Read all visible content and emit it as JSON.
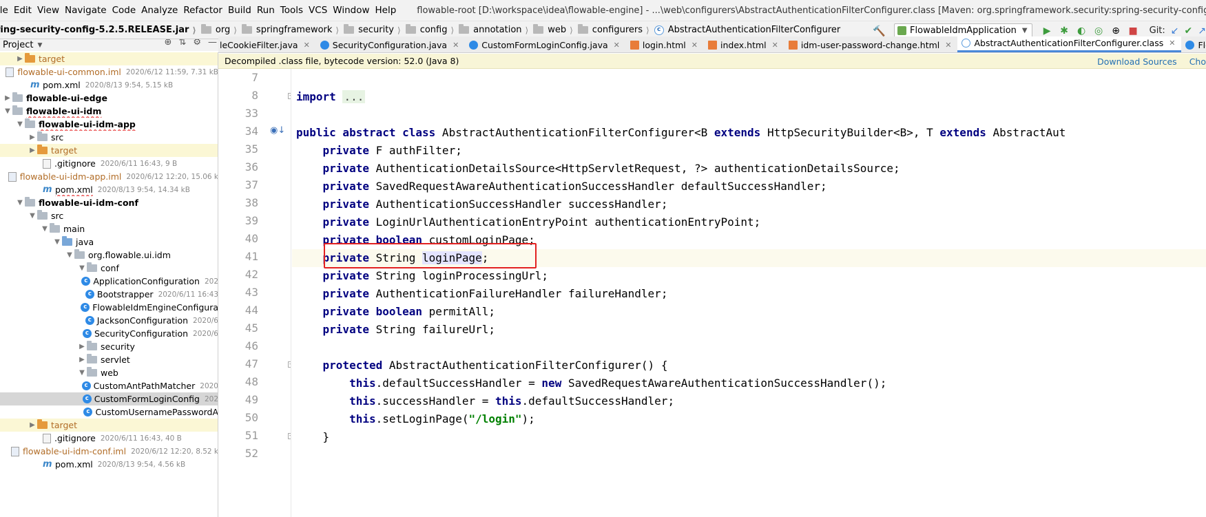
{
  "menu": [
    "ile",
    "Edit",
    "View",
    "Navigate",
    "Code",
    "Analyze",
    "Refactor",
    "Build",
    "Run",
    "Tools",
    "VCS",
    "Window",
    "Help"
  ],
  "window_title": "flowable-root [D:\\workspace\\idea\\flowable-engine] - ...\\web\\configurers\\AbstractAuthenticationFilterConfigurer.class [Maven: org.springframework.security:spring-security-config:5.2.5.RELEASE]",
  "breadcrumb": {
    "jar": "ring-security-config-5.2.5.RELEASE.jar",
    "segments": [
      "org",
      "springframework",
      "security",
      "config",
      "annotation",
      "web",
      "configurers"
    ],
    "class": "AbstractAuthenticationFilterConfigurer"
  },
  "toolbar": {
    "run_config": "FlowableIdmApplication",
    "git_label": "Git:"
  },
  "project": {
    "title": "Project",
    "rows": [
      {
        "name": "target",
        "meta": ""
      },
      {
        "name": "flowable-ui-common.iml",
        "meta": "2020/6/12 11:59, 7.31 kB"
      },
      {
        "name": "pom.xml",
        "meta": "2020/8/13 9:54, 5.15 kB"
      },
      {
        "name": "flowable-ui-edge",
        "meta": ""
      },
      {
        "name": "flowable-ui-idm",
        "meta": ""
      },
      {
        "name": "flowable-ui-idm-app",
        "meta": ""
      },
      {
        "name": "src",
        "meta": ""
      },
      {
        "name": "target",
        "meta": ""
      },
      {
        "name": ".gitignore",
        "meta": "2020/6/11 16:43, 9 B"
      },
      {
        "name": "flowable-ui-idm-app.iml",
        "meta": "2020/6/12 12:20, 15.06 k"
      },
      {
        "name": "pom.xml",
        "meta": "2020/8/13 9:54, 14.34 kB"
      },
      {
        "name": "flowable-ui-idm-conf",
        "meta": ""
      },
      {
        "name": "src",
        "meta": ""
      },
      {
        "name": "main",
        "meta": ""
      },
      {
        "name": "java",
        "meta": ""
      },
      {
        "name": "org.flowable.ui.idm",
        "meta": ""
      },
      {
        "name": "conf",
        "meta": ""
      },
      {
        "name": "ApplicationConfiguration",
        "meta": "202"
      },
      {
        "name": "Bootstrapper",
        "meta": "2020/6/11 16:43"
      },
      {
        "name": "FlowableIdmEngineConfigura",
        "meta": ""
      },
      {
        "name": "JacksonConfiguration",
        "meta": "2020/6"
      },
      {
        "name": "SecurityConfiguration",
        "meta": "2020/6"
      },
      {
        "name": "security",
        "meta": ""
      },
      {
        "name": "servlet",
        "meta": ""
      },
      {
        "name": "web",
        "meta": ""
      },
      {
        "name": "CustomAntPathMatcher",
        "meta": "2020"
      },
      {
        "name": "CustomFormLoginConfig",
        "meta": "202"
      },
      {
        "name": "CustomUsernamePasswordA",
        "meta": ""
      },
      {
        "name": "target",
        "meta": ""
      },
      {
        "name": ".gitignore",
        "meta": "2020/6/11 16:43, 40 B"
      },
      {
        "name": "flowable-ui-idm-conf.iml",
        "meta": "2020/6/12 12:20, 8.52 k"
      },
      {
        "name": "pom.xml",
        "meta": "2020/8/13 9:54, 4.56 kB"
      }
    ]
  },
  "tabs": [
    {
      "label": "leCookieFilter.java"
    },
    {
      "label": "SecurityConfiguration.java"
    },
    {
      "label": "CustomFormLoginConfig.java"
    },
    {
      "label": "login.html"
    },
    {
      "label": "index.html"
    },
    {
      "label": "idm-user-password-change.html"
    },
    {
      "label": "AbstractAuthenticationFilterConfigurer.class"
    },
    {
      "label": "FlowableIdmA"
    }
  ],
  "banner": {
    "message": "Decompiled .class file, bytecode version: 52.0 (Java 8)",
    "download_sources": "Download Sources",
    "choose_sources": "Cho"
  },
  "code": {
    "line_numbers": [
      "7",
      "8",
      "33",
      "34",
      "35",
      "36",
      "37",
      "38",
      "39",
      "40",
      "41",
      "42",
      "43",
      "44",
      "45",
      "46",
      "47",
      "48",
      "49",
      "50",
      "51",
      "52"
    ],
    "lines": [
      [],
      [
        {
          "k": "kw",
          "t": "import"
        },
        {
          "k": "p",
          "t": " "
        },
        {
          "k": "fold",
          "t": "..."
        }
      ],
      [],
      [
        {
          "k": "kw",
          "t": "public abstract class"
        },
        {
          "k": "p",
          "t": " AbstractAuthenticationFilterConfigurer<B "
        },
        {
          "k": "kw",
          "t": "extends"
        },
        {
          "k": "p",
          "t": " HttpSecurityBuilder<B>, T "
        },
        {
          "k": "kw",
          "t": "extends"
        },
        {
          "k": "p",
          "t": " AbstractAut"
        }
      ],
      [
        {
          "k": "p",
          "t": "    "
        },
        {
          "k": "kw",
          "t": "private"
        },
        {
          "k": "p",
          "t": " F authFilter;"
        }
      ],
      [
        {
          "k": "p",
          "t": "    "
        },
        {
          "k": "kw",
          "t": "private"
        },
        {
          "k": "p",
          "t": " AuthenticationDetailsSource<HttpServletRequest, ?> authenticationDetailsSource;"
        }
      ],
      [
        {
          "k": "p",
          "t": "    "
        },
        {
          "k": "kw",
          "t": "private"
        },
        {
          "k": "p",
          "t": " SavedRequestAwareAuthenticationSuccessHandler defaultSuccessHandler;"
        }
      ],
      [
        {
          "k": "p",
          "t": "    "
        },
        {
          "k": "kw",
          "t": "private"
        },
        {
          "k": "p",
          "t": " AuthenticationSuccessHandler successHandler;"
        }
      ],
      [
        {
          "k": "p",
          "t": "    "
        },
        {
          "k": "kw",
          "t": "private"
        },
        {
          "k": "p",
          "t": " LoginUrlAuthenticationEntryPoint authenticationEntryPoint;"
        }
      ],
      [
        {
          "k": "p",
          "t": "    "
        },
        {
          "k": "kw",
          "t": "private boolean"
        },
        {
          "k": "p",
          "t": " customLoginPage;"
        }
      ],
      [
        {
          "k": "p",
          "t": "    "
        },
        {
          "k": "kw",
          "t": "private"
        },
        {
          "k": "p",
          "t": " String "
        },
        {
          "k": "id",
          "t": "loginPage"
        },
        {
          "k": "p",
          "t": ";"
        }
      ],
      [
        {
          "k": "p",
          "t": "    "
        },
        {
          "k": "kw",
          "t": "private"
        },
        {
          "k": "p",
          "t": " String loginProcessingUrl;"
        }
      ],
      [
        {
          "k": "p",
          "t": "    "
        },
        {
          "k": "kw",
          "t": "private"
        },
        {
          "k": "p",
          "t": " AuthenticationFailureHandler failureHandler;"
        }
      ],
      [
        {
          "k": "p",
          "t": "    "
        },
        {
          "k": "kw",
          "t": "private boolean"
        },
        {
          "k": "p",
          "t": " permitAll;"
        }
      ],
      [
        {
          "k": "p",
          "t": "    "
        },
        {
          "k": "kw",
          "t": "private"
        },
        {
          "k": "p",
          "t": " String failureUrl;"
        }
      ],
      [],
      [
        {
          "k": "p",
          "t": "    "
        },
        {
          "k": "kw",
          "t": "protected"
        },
        {
          "k": "p",
          "t": " AbstractAuthenticationFilterConfigurer() {"
        }
      ],
      [
        {
          "k": "p",
          "t": "        "
        },
        {
          "k": "kw",
          "t": "this"
        },
        {
          "k": "p",
          "t": ".defaultSuccessHandler = "
        },
        {
          "k": "kw",
          "t": "new"
        },
        {
          "k": "p",
          "t": " SavedRequestAwareAuthenticationSuccessHandler();"
        }
      ],
      [
        {
          "k": "p",
          "t": "        "
        },
        {
          "k": "kw",
          "t": "this"
        },
        {
          "k": "p",
          "t": ".successHandler = "
        },
        {
          "k": "kw",
          "t": "this"
        },
        {
          "k": "p",
          "t": ".defaultSuccessHandler;"
        }
      ],
      [
        {
          "k": "p",
          "t": "        "
        },
        {
          "k": "kw",
          "t": "this"
        },
        {
          "k": "p",
          "t": ".setLoginPage("
        },
        {
          "k": "str",
          "t": "\"/login\""
        },
        {
          "k": "p",
          "t": ");"
        }
      ],
      [
        {
          "k": "p",
          "t": "    }"
        }
      ],
      []
    ]
  }
}
